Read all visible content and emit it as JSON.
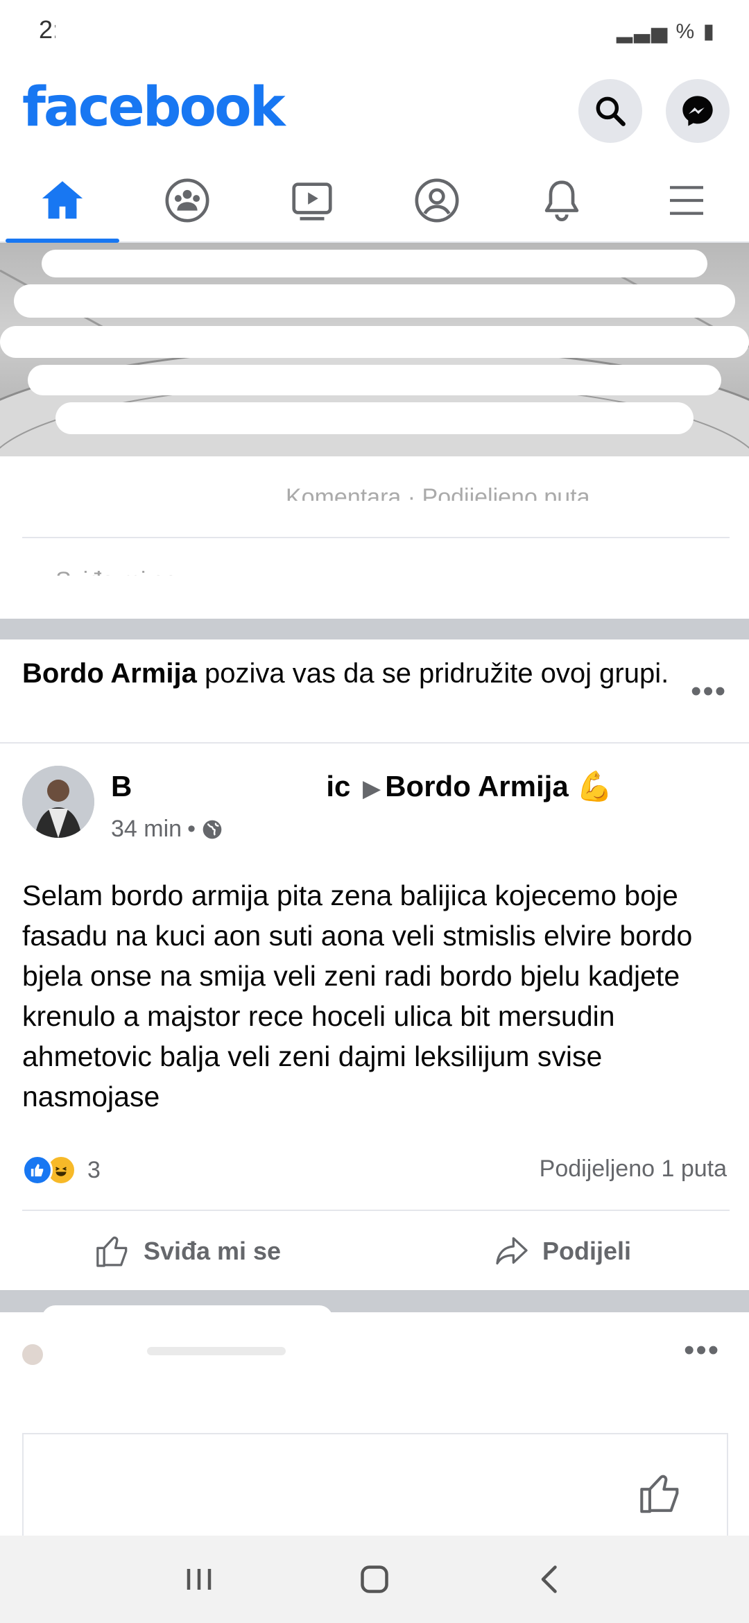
{
  "status_bar": {
    "time": "2:",
    "right": "%"
  },
  "header": {
    "logo": "facebook"
  },
  "tabs": [
    {
      "name": "home"
    },
    {
      "name": "groups"
    },
    {
      "name": "watch"
    },
    {
      "name": "profile"
    },
    {
      "name": "notifications"
    },
    {
      "name": "menu"
    }
  ],
  "post1": {
    "stats_left": "",
    "stats_right": "Komentara · Podijeljeno puta",
    "like_label": "Sviđa mi se"
  },
  "invite": {
    "group_name": "Bordo Armija",
    "text": " poziva vas da se pridružite ovoj grupi."
  },
  "post2": {
    "author_visible": "B",
    "author_tail": "ic",
    "group": "Bordo Armija",
    "emoji": "💪",
    "time": "34 min",
    "separator": "•",
    "text": "Selam bordo armija pita zena balijica kojecemo boje fasadu na kuci aon suti aona veli stmislis elvire bordo bjela onse na smija veli zeni radi bordo bjelu kadjete krenulo a majstor rece hoceli ulica bit mersudin ahmetovic balja veli zeni dajmi leksilijum svise nasmojase",
    "reaction_count": "3",
    "shares": "Podijeljeno 1 puta",
    "like_label": "Sviđa mi se",
    "share_label": "Podijeli"
  },
  "more": "•••",
  "colors": {
    "brand": "#1877f2",
    "muted": "#65676b",
    "divider": "#e4e6eb"
  }
}
